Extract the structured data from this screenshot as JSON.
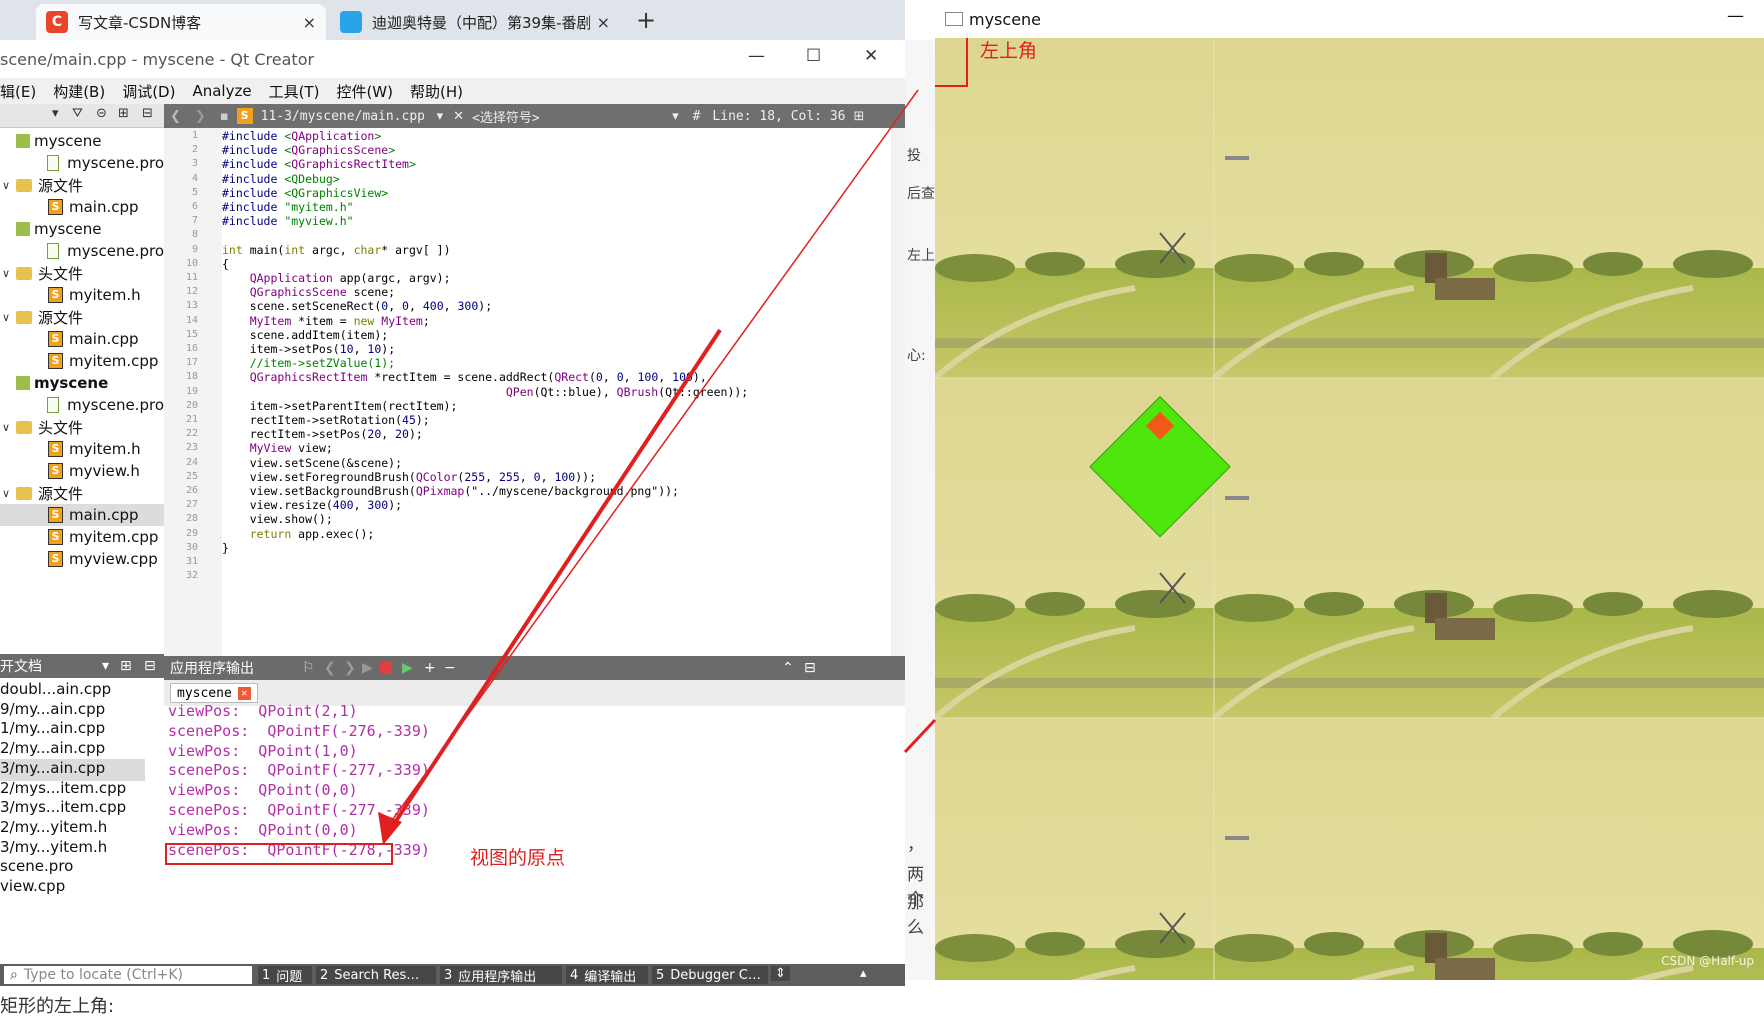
{
  "browser": {
    "tabs": [
      {
        "icon": "C",
        "label": "写文章-CSDN博客",
        "close": "×"
      },
      {
        "icon": "",
        "label": "迪迦奥特曼（中配）第39集-番剧",
        "close": "×"
      }
    ],
    "new_tab": "+"
  },
  "qt": {
    "title": "scene/main.cpp - myscene - Qt Creator",
    "win_min": "—",
    "win_max": "☐",
    "win_close": "✕",
    "menu": [
      "辑(E)",
      "构建(B)",
      "调试(D)",
      "Analyze",
      "工具(T)",
      "控件(W)",
      "帮助(H)"
    ],
    "editor_toolbar": {
      "file": "11-3/myscene/main.cpp",
      "symbol": "<选择符号>",
      "hash": "#",
      "position": "Line: 18, Col: 36"
    },
    "project_tree": [
      {
        "label": "myscene",
        "icon": "project",
        "level": 0
      },
      {
        "label": "myscene.pro",
        "icon": "pro",
        "level": 1
      },
      {
        "label": "源文件",
        "icon": "folder",
        "level": 0,
        "arrow": "∨"
      },
      {
        "label": "main.cpp",
        "icon": "cpp",
        "level": 1
      },
      {
        "label": "myscene",
        "icon": "project",
        "level": 0
      },
      {
        "label": "myscene.pro",
        "icon": "pro",
        "level": 1
      },
      {
        "label": "头文件",
        "icon": "folder",
        "level": 0,
        "arrow": "∨"
      },
      {
        "label": "myitem.h",
        "icon": "cpp",
        "level": 1
      },
      {
        "label": "源文件",
        "icon": "folder",
        "level": 0,
        "arrow": "∨"
      },
      {
        "label": "main.cpp",
        "icon": "cpp",
        "level": 1
      },
      {
        "label": "myitem.cpp",
        "icon": "cpp",
        "level": 1
      },
      {
        "label": "myscene",
        "icon": "project",
        "level": 0,
        "bold": true
      },
      {
        "label": "myscene.pro",
        "icon": "pro",
        "level": 1
      },
      {
        "label": "头文件",
        "icon": "folder",
        "level": 0,
        "arrow": "∨"
      },
      {
        "label": "myitem.h",
        "icon": "cpp",
        "level": 1
      },
      {
        "label": "myview.h",
        "icon": "cpp",
        "level": 1
      },
      {
        "label": "源文件",
        "icon": "folder",
        "level": 0,
        "arrow": "∨"
      },
      {
        "label": "main.cpp",
        "icon": "cpp",
        "level": 1,
        "selected": true
      },
      {
        "label": "myitem.cpp",
        "icon": "cpp",
        "level": 1
      },
      {
        "label": "myview.cpp",
        "icon": "cpp",
        "level": 1
      }
    ],
    "open_docs_title": "开文档",
    "open_docs": [
      "doubl...ain.cpp",
      "9/my...ain.cpp",
      "1/my...ain.cpp",
      "2/my...ain.cpp",
      "3/my...ain.cpp",
      "2/mys...item.cpp",
      "3/mys...item.cpp",
      "2/my...yitem.h",
      "3/my...yitem.h",
      "scene.pro",
      "view.cpp"
    ],
    "code_lines": [
      "#include <QApplication>",
      "#include <QGraphicsScene>",
      "#include <QGraphicsRectItem>",
      "#include <QDebug>",
      "#include <QGraphicsView>",
      "#include \"myitem.h\"",
      "#include \"myview.h\"",
      "",
      "int main(int argc, char* argv[ ])",
      "{",
      "    QApplication app(argc, argv);",
      "    QGraphicsScene scene;",
      "    scene.setSceneRect(0, 0, 400, 300);",
      "    MyItem *item = new MyItem;",
      "    scene.addItem(item);",
      "    item->setPos(10, 10);",
      "    //item->setZValue(1);",
      "    QGraphicsRectItem *rectItem = scene.addRect(QRect(0, 0, 100, 100),",
      "                                         QPen(Qt::blue), QBrush(Qt::green));",
      "    item->setParentItem(rectItem);",
      "    rectItem->setRotation(45);",
      "    rectItem->setPos(20, 20);",
      "    MyView view;",
      "    view.setScene(&scene);",
      "    view.setForegroundBrush(QColor(255, 255, 0, 100));",
      "    view.setBackgroundBrush(QPixmap(\"../myscene/background.png\"));",
      "    view.resize(400, 300);",
      "    view.show();",
      "    return app.exec();",
      "}",
      "",
      ""
    ],
    "output_title": "应用程序输出",
    "output_tab": "myscene",
    "output_lines": [
      "viewPos:  QPoint(2,1)",
      "scenePos:  QPointF(-276,-339)",
      "viewPos:  QPoint(1,0)",
      "scenePos:  QPointF(-277,-339)",
      "viewPos:  QPoint(0,0)",
      "scenePos:  QPointF(-277,-339)",
      "viewPos:  QPoint(0,0)",
      "scenePos:  QPointF(-278,-339)"
    ],
    "locate_placeholder": "Type to locate (Ctrl+K)",
    "status_tabs": [
      {
        "num": "1",
        "label": "问题"
      },
      {
        "num": "2",
        "label": "Search Res…"
      },
      {
        "num": "3",
        "label": "应用程序输出"
      },
      {
        "num": "4",
        "label": "编译输出"
      },
      {
        "num": "5",
        "label": "Debugger C…"
      }
    ],
    "bottom_caption": "矩形的左上角:"
  },
  "behind_text": [
    "投",
    "后查",
    "左上",
    "心:",
    "，",
    "两个",
    "那么"
  ],
  "scene_window": {
    "title": "myscene",
    "min": "—"
  },
  "annotations": {
    "top_left": "左上角",
    "view_origin": "视图的原点"
  },
  "watermark": "CSDN @Half-up",
  "colors": {
    "annotation_red": "#e02020",
    "output_magenta": "#b32fa8",
    "rect_green": "#4fe60f",
    "item_red": "#f05a16"
  }
}
